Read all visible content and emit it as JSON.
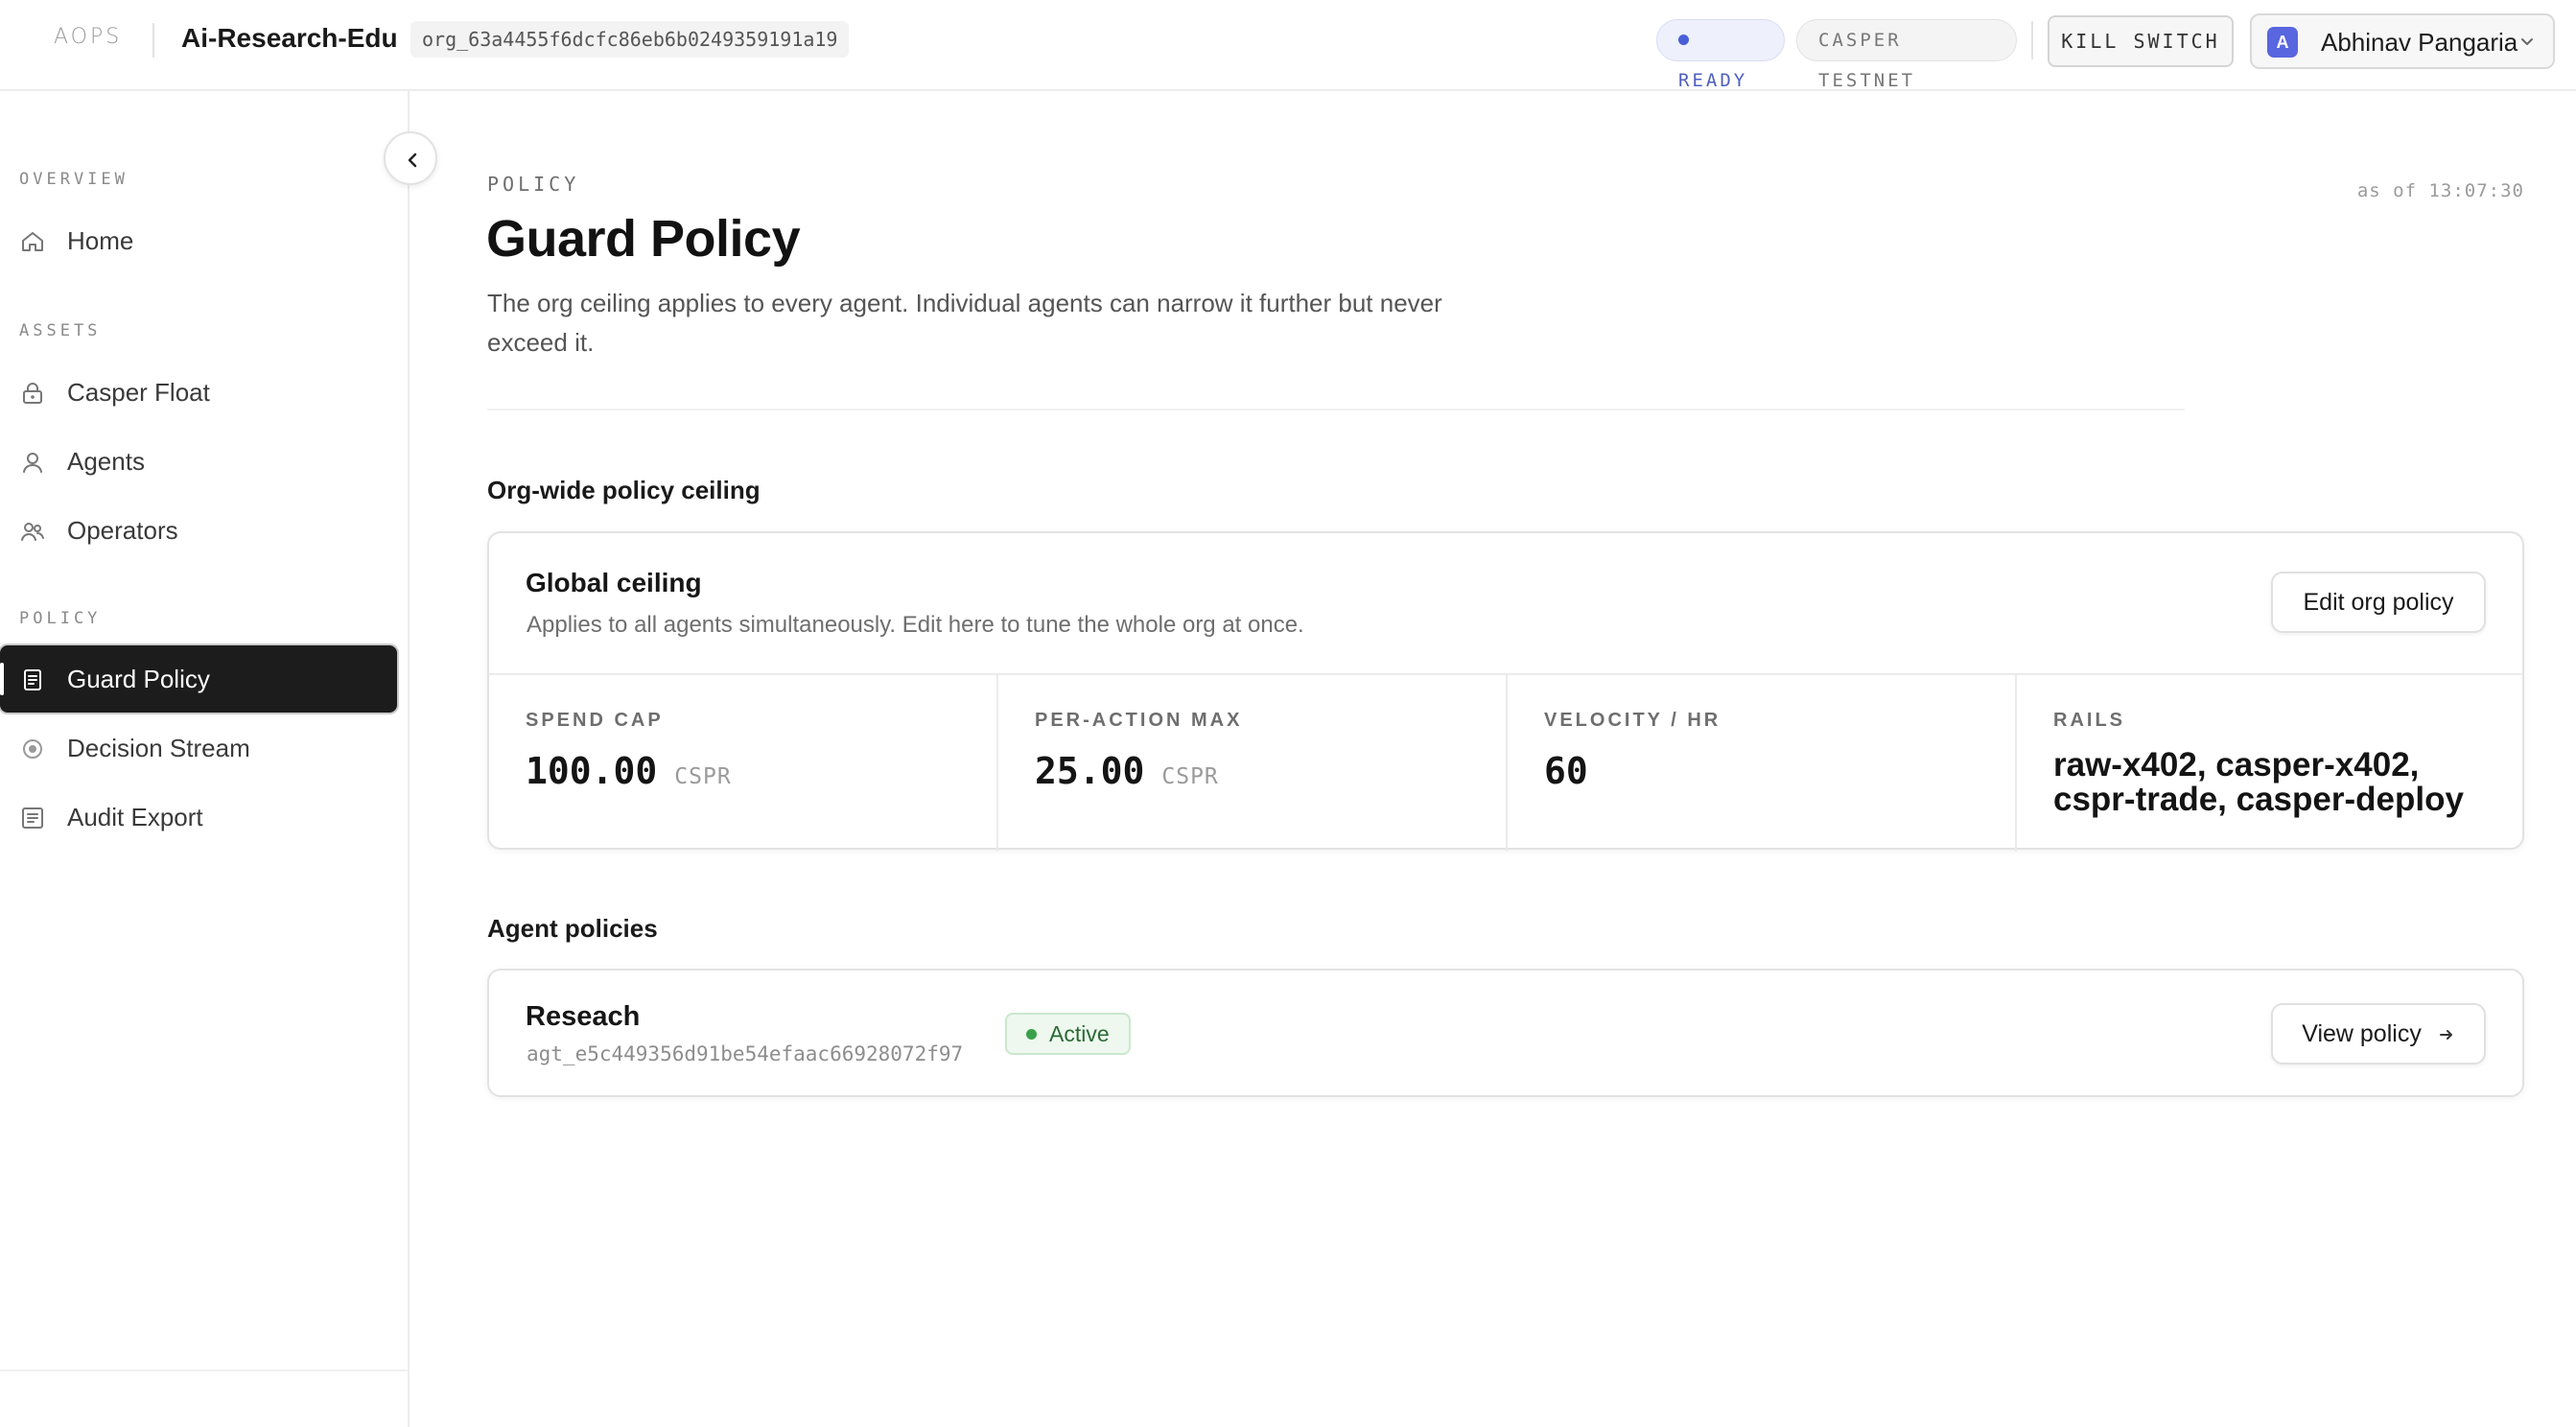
{
  "topbar": {
    "logo_text": "AOPS",
    "org_name": "Ai-Research-Edu",
    "org_id": "org_63a4455f6dcfc86eb6b0249359191a19",
    "status": "READY",
    "network": "CASPER TESTNET",
    "kill_switch": "KILL SWITCH",
    "user": {
      "initial": "A",
      "name": "Abhinav Pangaria"
    }
  },
  "sidebar": {
    "sections": [
      {
        "label": "OVERVIEW",
        "items": [
          {
            "label": "Home",
            "icon": "home-icon"
          }
        ]
      },
      {
        "label": "ASSETS",
        "items": [
          {
            "label": "Casper Float",
            "icon": "lock-icon"
          },
          {
            "label": "Agents",
            "icon": "user-icon"
          },
          {
            "label": "Operators",
            "icon": "users-icon"
          }
        ]
      },
      {
        "label": "POLICY",
        "items": [
          {
            "label": "Guard Policy",
            "icon": "document-icon",
            "active": true
          },
          {
            "label": "Decision Stream",
            "icon": "target-icon"
          },
          {
            "label": "Audit Export",
            "icon": "list-icon"
          }
        ]
      }
    ]
  },
  "page": {
    "eyebrow": "POLICY",
    "title": "Guard Policy",
    "description": "The org ceiling applies to every agent. Individual agents can narrow it further but never exceed it.",
    "as_of": "as of 13:07:30"
  },
  "org_policy": {
    "section_title": "Org-wide policy ceiling",
    "card_title": "Global ceiling",
    "card_subtitle": "Applies to all agents simultaneously. Edit here to tune the whole org at once.",
    "edit_button": "Edit org policy",
    "metrics": [
      {
        "label": "SPEND CAP",
        "value": "100.00",
        "unit": "CSPR"
      },
      {
        "label": "PER-ACTION MAX",
        "value": "25.00",
        "unit": "CSPR"
      },
      {
        "label": "VELOCITY / HR",
        "value": "60",
        "unit": ""
      },
      {
        "label": "RAILS",
        "value": "raw-x402, casper-x402, cspr-trade, casper-deploy",
        "unit": ""
      }
    ]
  },
  "agent_policies": {
    "section_title": "Agent policies",
    "agents": [
      {
        "name": "Reseach",
        "id": "agt_e5c449356d91be54efaac66928072f97",
        "status": "Active",
        "button": "View policy"
      }
    ]
  },
  "colors": {
    "accent": "#4a5fd7",
    "active_nav": "#1c1c1c",
    "active_badge": "#3aa14a"
  }
}
